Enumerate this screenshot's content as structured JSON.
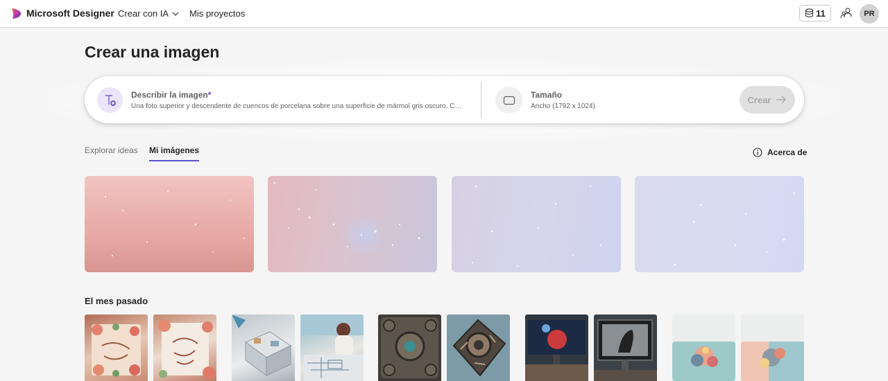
{
  "header": {
    "brand": "Microsoft Designer",
    "nav_ai": "Crear con IA",
    "nav_projects": "Mis proyectos",
    "credits": "11",
    "avatar_initials": "PR"
  },
  "page": {
    "title": "Crear una imagen"
  },
  "prompt": {
    "describe_label": "Describir la imagen",
    "required_mark": "*",
    "placeholder": "Una foto superior y descendente de cuencos de porcelana sobre una superficie de mármol gris oscuro. Camera angle: top-down, soft natural lighting",
    "size_label": "Tamaño",
    "size_value": "Ancho (1792 x 1024)",
    "create_label": "Crear"
  },
  "tabs": [
    {
      "label": "Explorar ideas",
      "active": false
    },
    {
      "label": "Mi imágenes",
      "active": true
    }
  ],
  "about_label": "Acerca de",
  "section_last_month": "El mes pasado",
  "icons": {
    "logo": "designer-logo-icon",
    "chevron": "chevron-down-icon",
    "credits": "coins-icon",
    "share": "share-people-icon",
    "text_prompt": "text-add-icon",
    "size": "aspect-ratio-icon",
    "arrow": "arrow-right-icon",
    "info": "info-icon"
  },
  "colors": {
    "accent": "#5b4fcf",
    "brand_gradient": [
      "#f0522f",
      "#c239b3",
      "#4f2f9e"
    ]
  }
}
